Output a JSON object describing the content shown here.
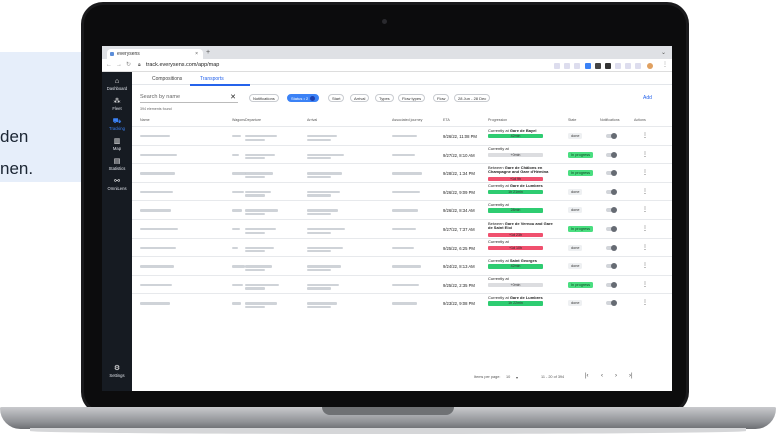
{
  "background": {
    "lines": [
      "den",
      "nen."
    ]
  },
  "browser": {
    "tab_title": "everysens",
    "url": "track.everysens.com/app/map"
  },
  "sidebar": {
    "items": [
      {
        "label": "Dashboard",
        "icon": "home-icon",
        "glyph": "⌂"
      },
      {
        "label": "Fleet",
        "icon": "fleet-icon",
        "glyph": "⁂"
      },
      {
        "label": "Tracking",
        "icon": "tracking-icon",
        "glyph": "⛟",
        "active": true
      },
      {
        "label": "Map",
        "icon": "map-icon",
        "glyph": "▥"
      },
      {
        "label": "Statistics",
        "icon": "statistics-icon",
        "glyph": "▤"
      },
      {
        "label": "OmniLens",
        "icon": "omnilens-icon",
        "glyph": "⚯"
      },
      {
        "label": "Settings",
        "icon": "settings-icon",
        "glyph": "⚙"
      }
    ]
  },
  "tabs": [
    {
      "label": "Compositions"
    },
    {
      "label": "Transports",
      "active": true
    }
  ],
  "search": {
    "placeholder": "Search by name"
  },
  "found_text": "394 elements found",
  "filters": [
    {
      "label": "Notifications"
    },
    {
      "label": "Status • 2",
      "active": true
    },
    {
      "label": "Start"
    },
    {
      "label": "Arrival"
    },
    {
      "label": "Types"
    },
    {
      "label": "Flow types"
    },
    {
      "label": "Flow"
    },
    {
      "label": "28 Jun - 28 Dec"
    }
  ],
  "add_label": "Add",
  "columns": [
    "Name",
    "Wagons",
    "Departure",
    "Arrival",
    "Associated journey",
    "ETA",
    "Progression",
    "State",
    "Notifications",
    "Actions"
  ],
  "rows": [
    {
      "eta": "9/26/22, 11:08 PM",
      "pre": "Currently at",
      "place": "Gare de Bayel",
      "bar": "42min",
      "bar_color": "green",
      "state": "done",
      "state_kind": "done"
    },
    {
      "eta": "9/27/22, 8:10 AM",
      "pre": "Currently at",
      "place": "",
      "bar": "+0min",
      "bar_color": "grey",
      "state": "In progress",
      "state_kind": "progress"
    },
    {
      "eta": "9/28/22, 1:34 PM",
      "pre": "Between",
      "place": "Gare de Châlons en Champagne and Gare d'Hémina",
      "bar": "+1d 9h",
      "bar_color": "red",
      "state": "In progress",
      "state_kind": "progress"
    },
    {
      "eta": "9/26/22, 9:09 PM",
      "pre": "Currently at",
      "place": "Gare de Lumbres",
      "bar": "1h 21min",
      "bar_color": "green",
      "state": "done",
      "state_kind": "done"
    },
    {
      "eta": "9/26/22, 8:34 AM",
      "pre": "Currently at",
      "place": "",
      "bar": "28min",
      "bar_color": "green",
      "state": "done",
      "state_kind": "done"
    },
    {
      "eta": "9/27/22, 7:37 AM",
      "pre": "Between",
      "place": "Gare de Vernou and Gare de Saint Eloi",
      "bar": "+1d 23h",
      "bar_color": "red",
      "state": "In progress",
      "state_kind": "progress"
    },
    {
      "eta": "9/25/22, 6:25 PM",
      "pre": "Currently at",
      "place": "",
      "bar": "+1d 10h",
      "bar_color": "red",
      "state": "done",
      "state_kind": "done"
    },
    {
      "eta": "9/24/22, 8:13 AM",
      "pre": "Currently at",
      "place": "Saint Georges",
      "bar": "42min",
      "bar_color": "green",
      "state": "done",
      "state_kind": "done"
    },
    {
      "eta": "9/25/22, 2:35 PM",
      "pre": "Currently at",
      "place": "",
      "bar": "+0min",
      "bar_color": "grey",
      "state": "In progress",
      "state_kind": "progress"
    },
    {
      "eta": "9/23/22, 9:08 PM",
      "pre": "Currently at",
      "place": "Gare de Lumbres",
      "bar": "1h 22min",
      "bar_color": "green",
      "state": "done",
      "state_kind": "done"
    }
  ],
  "pager": {
    "items_per_page_label": "Items per page:",
    "items_per_page": "10",
    "range": "11 - 20 of 394"
  },
  "colors": {
    "accent": "#3b82f6",
    "sidebar": "#161b22",
    "green": "#2ecc71",
    "red": "#f0506e"
  }
}
